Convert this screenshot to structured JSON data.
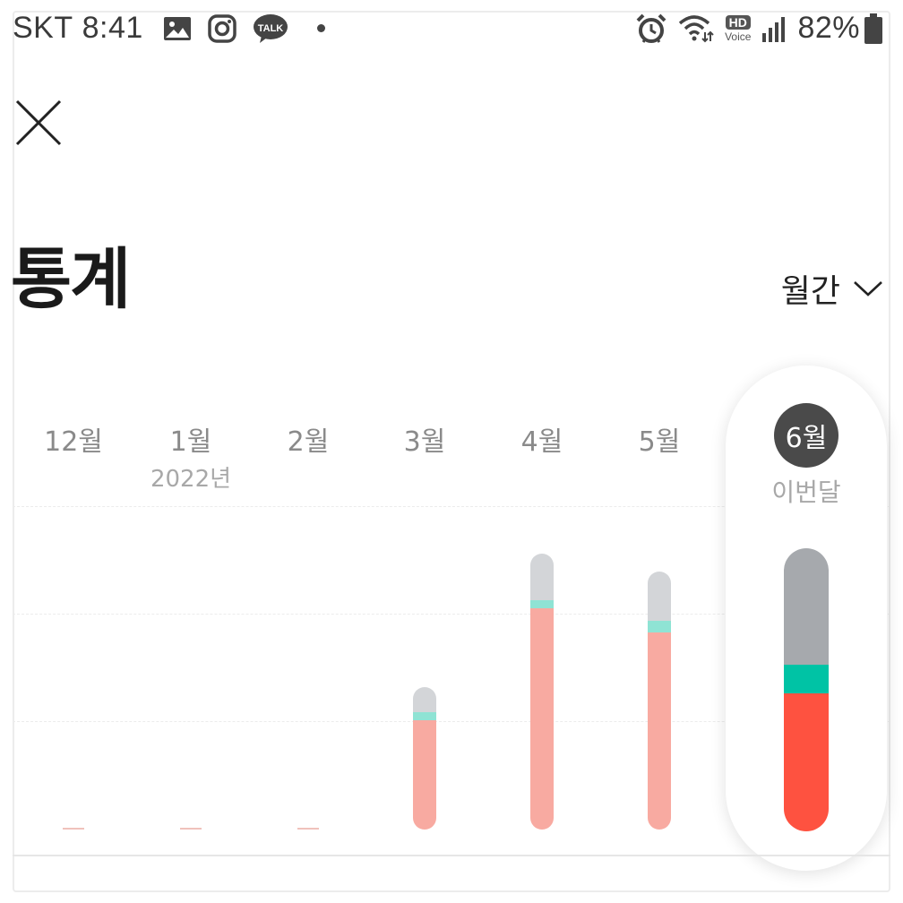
{
  "status_bar": {
    "carrier": "SKT",
    "time": "8:41",
    "hd_label": "HD",
    "voice_label": "Voice",
    "battery": "82%",
    "icons": [
      "gallery-icon",
      "instagram-icon",
      "kakaotalk-icon",
      "alarm-icon",
      "wifi-icon",
      "signal-icon",
      "battery-icon"
    ],
    "kakao_label": "TALK"
  },
  "header": {
    "title": "통계",
    "period": "월간"
  },
  "chart_data": {
    "type": "bar",
    "stacked": true,
    "categories": [
      "12월",
      "1월",
      "2월",
      "3월",
      "4월",
      "5월",
      "6월"
    ],
    "year_marker": "2022년",
    "current_label": "이번달",
    "series": [
      {
        "color": "#f8aaa1",
        "values": [
          0.4,
          0.5,
          0.3,
          12,
          24.2,
          21.6,
          15
        ]
      },
      {
        "color": "#8fe3d4",
        "values": [
          0,
          0,
          0,
          0.8,
          0.9,
          1.2,
          3
        ]
      },
      {
        "color": "#d3d5d8",
        "values": [
          0,
          0,
          0,
          2.8,
          5.1,
          5.4,
          12
        ]
      }
    ],
    "current_colors": [
      "#fe5240",
      "#00c3a5",
      "#a6a9ad"
    ],
    "grid": true
  },
  "colors": {
    "accent_red": "#fe5240",
    "accent_teal": "#00c3a5",
    "badge_bg": "#4a4a4a"
  }
}
